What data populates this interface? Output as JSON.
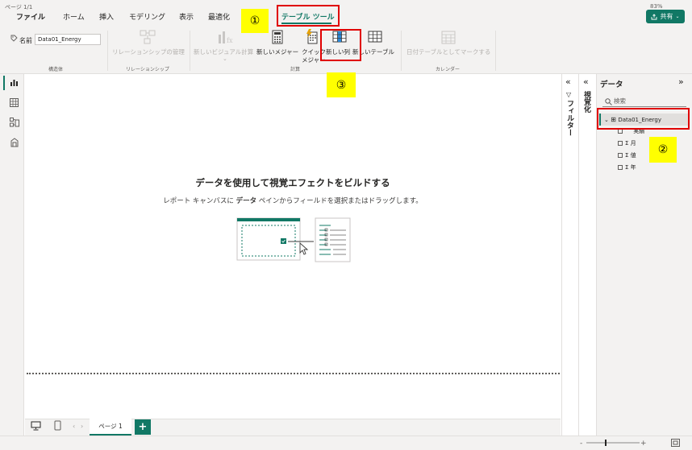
{
  "ribbon_tabs": {
    "file": "ファイル",
    "home": "ホーム",
    "insert": "挿入",
    "modeling": "モデリング",
    "view": "表示",
    "optimize": "最適化",
    "table_tools": "テーブル ツール"
  },
  "share_label": "共有",
  "ribbon": {
    "name_label": "名前",
    "name_value": "Data01_Energy",
    "group_structure": "構造体",
    "manage_relationships": "リレーションシップの管理",
    "group_relationships": "リレーションシップ",
    "new_visual_calc": "新しいビジュアル計算",
    "new_measure": "新しいメジャー",
    "quick_measure_line1": "クイック",
    "quick_measure_line2": "メジャー",
    "new_column": "新しい列",
    "new_table": "新しいテーブル",
    "group_calculations": "計算",
    "mark_as_date_table": "日付テーブルとしてマークする",
    "group_calendar": "カレンダー"
  },
  "canvas": {
    "empty_title": "データを使用して視覚エフェクトをビルドする",
    "empty_sub_before": "レポート キャンバスに ",
    "empty_sub_bold": "データ",
    "empty_sub_after": " ペインからフィールドを選択またはドラッグします。"
  },
  "page_tab": "ページ 1",
  "status": {
    "page": "ページ 1/1",
    "zoom": "83%"
  },
  "panes": {
    "filter": "フィルター",
    "visualizations": "視覚化",
    "data_title": "データ",
    "search_placeholder": "検索",
    "table_name": "Data01_Energy",
    "fields": [
      {
        "sigma": "",
        "name": "実績"
      },
      {
        "sigma": "Σ",
        "name": "月"
      },
      {
        "sigma": "Σ",
        "name": "値"
      },
      {
        "sigma": "Σ",
        "name": "年"
      }
    ]
  },
  "annotations": [
    "①",
    "②",
    "③"
  ],
  "colors": {
    "accent": "#117865",
    "annotation_border": "#e00000",
    "annotation_fill": "#ffff00"
  }
}
